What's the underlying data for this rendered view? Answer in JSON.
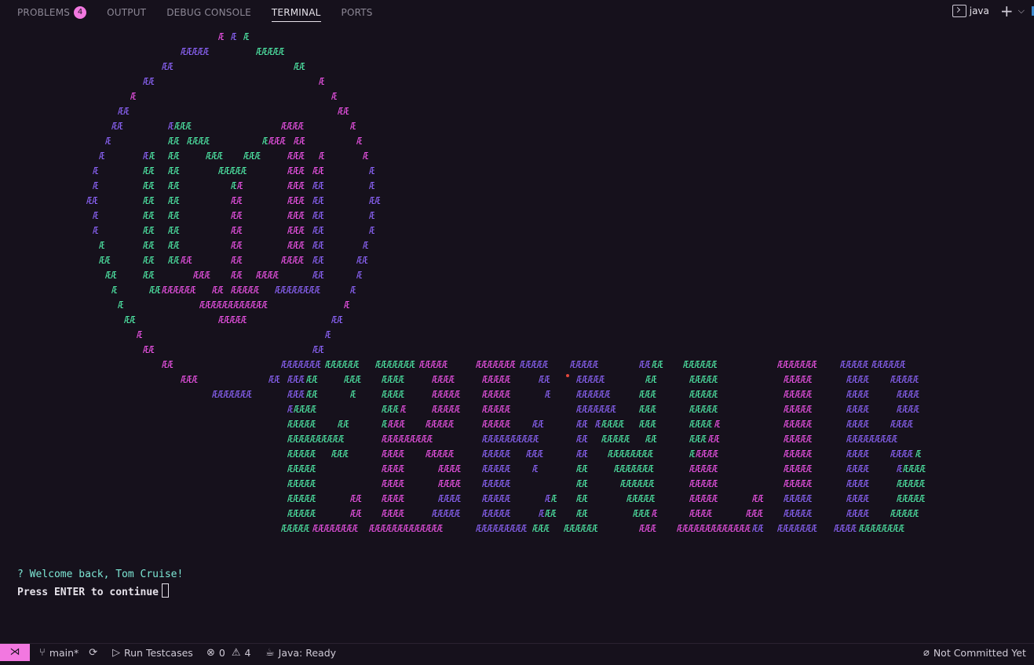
{
  "panel": {
    "tabs": [
      {
        "label": "PROBLEMS",
        "badge": "4"
      },
      {
        "label": "OUTPUT"
      },
      {
        "label": "DEBUG CONSOLE"
      },
      {
        "label": "TERMINAL"
      },
      {
        "label": "PORTS"
      }
    ],
    "terminal_name": "java"
  },
  "terminal": {
    "welcome": "? Welcome back, Tom Cruise!",
    "press_enter": "Press ENTER to continue"
  },
  "colors": {
    "green": "#4ee6a4",
    "purple": "#8b63f7",
    "magenta": "#ea52e4",
    "accent": "#f278e0"
  },
  "statusbar": {
    "branch": "main*",
    "run_testcases": "Run Testcases",
    "errors": "0",
    "warnings": "4",
    "java_status": "Java: Ready",
    "commit_status": "Not Committed Yet"
  }
}
